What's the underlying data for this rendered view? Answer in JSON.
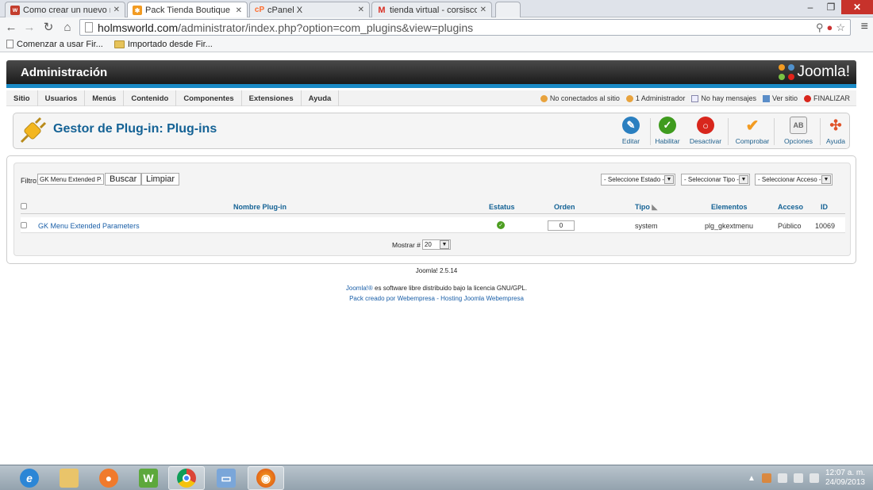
{
  "browser": {
    "tabs": [
      {
        "title": "Como crear un nuevo me",
        "fav": "w",
        "fav_color": "#c33d2d",
        "active": false
      },
      {
        "title": "Pack Tienda Boutique - A",
        "fav": "joomla",
        "fav_color": "#f29b22",
        "active": true
      },
      {
        "title": "cPanel X",
        "fav": "cP",
        "fav_color": "#ff6c2c",
        "active": false
      },
      {
        "title": "tienda virtual - corsiscom",
        "fav": "M",
        "fav_color": "#d93025",
        "active": false
      }
    ],
    "url_host": "holmsworld.com",
    "url_path": "/administrator/index.php?option=com_plugins&view=plugins",
    "bookmarks": [
      {
        "label": "Comenzar a usar Fir...",
        "icon": "page-icon"
      },
      {
        "label": "Importado desde Fir...",
        "icon": "folder-icon"
      }
    ]
  },
  "admin": {
    "header_title": "Administración",
    "logo_text": "Joomla!",
    "menu": [
      "Sitio",
      "Usuarios",
      "Menús",
      "Contenido",
      "Componentes",
      "Extensiones",
      "Ayuda"
    ],
    "status": {
      "visitors": "No conectados al sitio",
      "admins": "1 Administrador",
      "messages": "No hay mensajes",
      "view_site": "Ver sitio",
      "logout": "FINALIZAR"
    },
    "page_title": "Gestor de Plug-in: Plug-ins",
    "toolbar": [
      {
        "label": "Editar",
        "icon": "edit-icon",
        "color": "#2a7fc0"
      },
      {
        "label": "Habilitar",
        "icon": "check-icon",
        "color": "#3f9b1e"
      },
      {
        "label": "Desactivar",
        "icon": "stop-icon",
        "color": "#d8261c"
      },
      {
        "label": "Comprobar",
        "icon": "checkmark-icon",
        "color": "#f29b22"
      },
      {
        "label": "Opciones",
        "icon": "options-icon",
        "color": "#9a9a9a"
      },
      {
        "label": "Ayuda",
        "icon": "help-icon",
        "color": "#e0542a"
      }
    ],
    "filter": {
      "label": "Filtro:",
      "value": "GK Menu Extended Para",
      "search_btn": "Buscar",
      "clear_btn": "Limpiar",
      "state_select": "- Seleccione Estado -",
      "type_select": "- Seleccionar Tipo -",
      "access_select": "- Seleccionar Acceso -"
    },
    "table": {
      "headers": {
        "name": "Nombre Plug-in",
        "status": "Estatus",
        "order": "Orden",
        "type": "Tipo",
        "elements": "Elementos",
        "access": "Acceso",
        "id": "ID"
      },
      "rows": [
        {
          "name": "GK Menu Extended Parameters",
          "status": "enabled",
          "order": "0",
          "type": "system",
          "element": "plg_gkextmenu",
          "access": "Público",
          "id": "10069"
        }
      ]
    },
    "pagination": {
      "label": "Mostrar #",
      "value": "20"
    },
    "footer": {
      "version": "Joomla! 2.5.14",
      "license_link": "Joomla!®",
      "license_text": " es software libre distribuido bajo la licencia GNU/GPL.",
      "credit_prefix": "Pack creado por ",
      "credit_link1": "Webempresa",
      "credit_sep": " - ",
      "credit_link2": "Hosting Joomla Webempresa"
    }
  },
  "taskbar": {
    "time": "12:07 a. m.",
    "date": "24/09/2013"
  }
}
